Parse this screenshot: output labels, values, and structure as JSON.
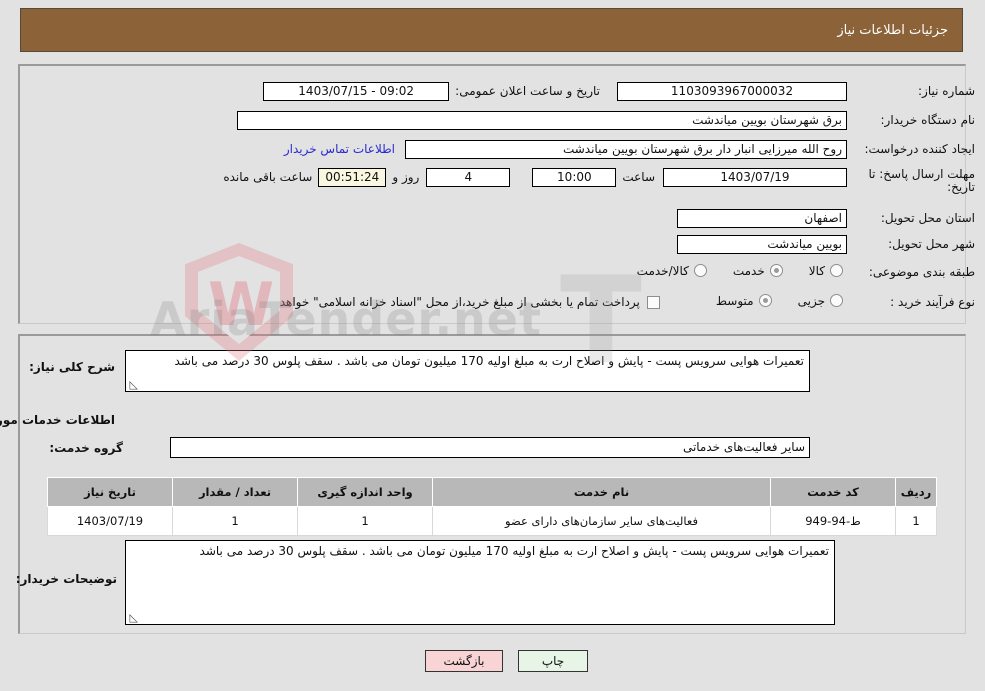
{
  "header": {
    "title": "جزئیات اطلاعات نیاز"
  },
  "fields": {
    "need_number_label": "شماره نیاز:",
    "need_number_value": "1103093967000032",
    "announce_label": "تاریخ و ساعت اعلان عمومی:",
    "announce_value": "09:02 - 1403/07/15",
    "buyer_org_label": "نام دستگاه خریدار:",
    "buyer_org_value": "برق شهرستان بویین میاندشت",
    "creator_label": "ایجاد کننده درخواست:",
    "creator_value": "روح الله  میرزایی  انبار دار  برق شهرستان بویین میاندشت",
    "contact_link": "اطلاعات تماس خریدار",
    "deadline_label": "مهلت ارسال پاسخ: تا تاریخ:",
    "deadline_date": "1403/07/19",
    "hour_label": "ساعت",
    "deadline_time": "10:00",
    "days_value": "4",
    "days_label": "روز و",
    "remaining_timer": "00:51:24",
    "remaining_label": "ساعت باقی مانده",
    "province_label": "استان محل تحویل:",
    "province_value": "اصفهان",
    "city_label": "شهر محل تحویل:",
    "city_value": "بویین میاندشت",
    "category_label": "طبقه بندی موضوعی:",
    "process_label": "نوع فرآیند خرید :",
    "treasury_note": "پرداخت تمام یا بخشی از مبلغ خرید،از محل \"اسناد خزانه اسلامی\" خواهد بود."
  },
  "category_options": [
    {
      "label": "کالا",
      "selected": false
    },
    {
      "label": "خدمت",
      "selected": true
    },
    {
      "label": "کالا/خدمت",
      "selected": false
    }
  ],
  "process_options": [
    {
      "label": "جزیی",
      "selected": false
    },
    {
      "label": "متوسط",
      "selected": true
    }
  ],
  "treasury_checked": false,
  "description": {
    "label": "شرح کلی نیاز:",
    "value": "تعمیرات هوایی سرویس پست - پایش و اصلاح ارت به مبلغ اولیه 170 میلیون تومان می باشد . سقف پلوس 30 درصد می باشد"
  },
  "services_section": {
    "title": "اطلاعات خدمات مورد نیاز",
    "group_label": "گروه خدمت:",
    "group_value": "سایر فعالیت‌های خدماتی"
  },
  "table": {
    "columns": [
      "ردیف",
      "کد خدمت",
      "نام خدمت",
      "واحد اندازه گیری",
      "تعداد / مقدار",
      "تاریخ نیاز"
    ],
    "rows": [
      {
        "row": "1",
        "code": "ط-94-949",
        "name": "فعالیت‌های سایر سازمان‌های دارای عضو",
        "unit": "1",
        "quantity": "1",
        "need_date": "1403/07/19"
      }
    ]
  },
  "buyer_comments": {
    "label": "توضیحات خریدار:",
    "value": "تعمیرات هوایی سرویس پست - پایش و اصلاح ارت به مبلغ اولیه 170 میلیون تومان می باشد . سقف پلوس 30 درصد می باشد"
  },
  "buttons": {
    "back": "بازگشت",
    "print": "چاپ"
  },
  "watermark": {
    "text": "AriaTender.net",
    "letter": "W",
    "big": "T"
  },
  "colors": {
    "header_bg": "#8c6239",
    "page_bg": "#e2e2e2",
    "link": "#2a2ad0",
    "timer_bg": "#faf7e0",
    "back_btn": "#f9d4d4",
    "print_btn": "#e7f5e7",
    "table_header": "#b8b8b8"
  }
}
